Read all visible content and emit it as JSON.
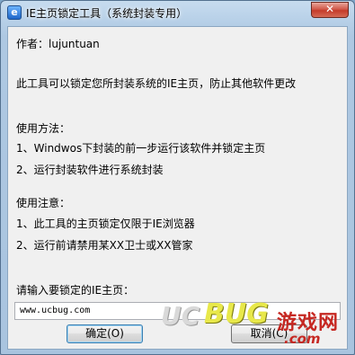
{
  "window": {
    "title": "IE主页锁定工具（系统封装专用）",
    "close_label": "✕"
  },
  "content": {
    "author": "作者：lujuntuan",
    "description": "此工具可以锁定您所封装系统的IE主页，防止其他软件更改",
    "usage_heading": "使用方法：",
    "usage_1": "1、Windwos下封装的前一步运行该软件并锁定主页",
    "usage_2": "2、运行封装软件进行系统封装",
    "notes_heading": "使用注意：",
    "notes_1": "1、此工具的主页锁定仅限于IE浏览器",
    "notes_2": "2、运行前请禁用某XX卫士或XX管家",
    "input_label": "请输入要锁定的IE主页："
  },
  "input": {
    "value": "www.ucbug.com"
  },
  "buttons": {
    "ok": "确定(O)",
    "cancel": "取消(C)"
  },
  "watermark": {
    "uc": "UC",
    "bug": "BUG",
    "cn": "游戏网",
    "com": ".com"
  }
}
